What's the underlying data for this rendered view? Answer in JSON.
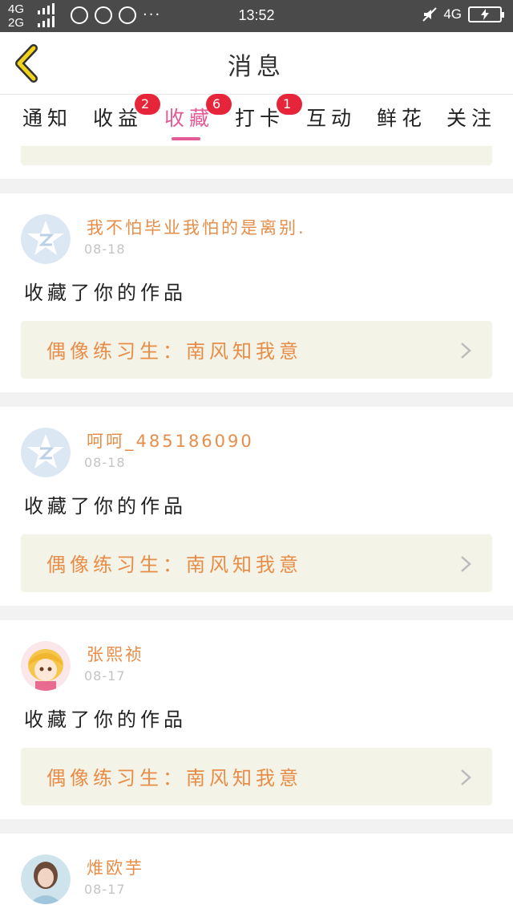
{
  "status_bar": {
    "network_top": "4G",
    "network_bottom": "2G",
    "time": "13:52",
    "network_right": "4G",
    "icons": [
      "signal-icon",
      "qq-icon",
      "wechat-icon",
      "qq-icon",
      "more-dots-icon",
      "mute-icon",
      "battery-charging-icon"
    ],
    "more": "···"
  },
  "header": {
    "title": "消息",
    "back_icon": "chevron-left-icon",
    "accent_color": "#f2d21b"
  },
  "tabs": [
    {
      "label": "通知",
      "badge": "",
      "active": false
    },
    {
      "label": "收益",
      "badge": "2",
      "active": false
    },
    {
      "label": "收藏",
      "badge": "6",
      "active": true
    },
    {
      "label": "打卡",
      "badge": "1",
      "active": false
    },
    {
      "label": "互动",
      "badge": "",
      "active": false
    },
    {
      "label": "鲜花",
      "badge": "",
      "active": false
    },
    {
      "label": "关注",
      "badge": "",
      "active": false
    }
  ],
  "colors": {
    "active_tab": "#e55a95",
    "badge": "#e7253a",
    "name": "#e88d48",
    "work_bg": "#f4f3e8"
  },
  "messages": [
    {
      "user": "我不怕毕业我怕的是离别.",
      "date": "08-18",
      "action": "收藏了你的作品",
      "work": "偶像练习生：南风知我意",
      "avatar": "default-avatar-icon"
    },
    {
      "user": "呵呵_485186090",
      "date": "08-18",
      "action": "收藏了你的作品",
      "work": "偶像练习生：南风知我意",
      "avatar": "default-avatar-icon"
    },
    {
      "user": "张熙祯",
      "date": "08-17",
      "action": "收藏了你的作品",
      "work": "偶像练习生：南风知我意",
      "avatar": "cartoon-girl-avatar"
    },
    {
      "user": "焳欧芋",
      "date": "08-17",
      "action": "",
      "work": "",
      "avatar": "photo-avatar"
    }
  ]
}
